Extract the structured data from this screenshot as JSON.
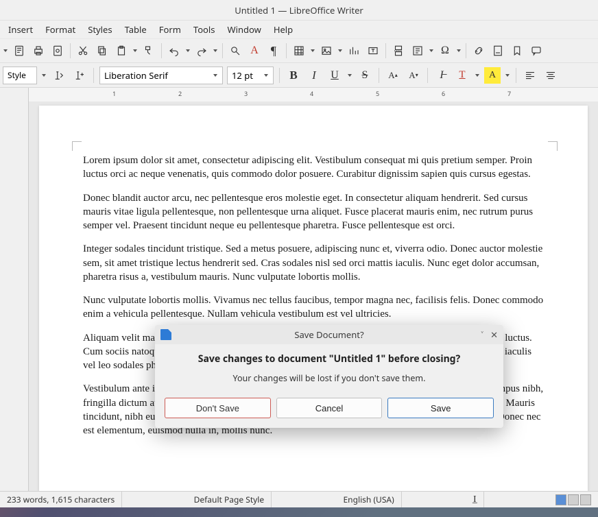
{
  "titlebar": "Untitled 1 — LibreOffice Writer",
  "menu": [
    "Insert",
    "Format",
    "Styles",
    "Table",
    "Form",
    "Tools",
    "Window",
    "Help"
  ],
  "toolbar2": {
    "style_label": "Style",
    "font_name": "Liberation Serif",
    "font_size": "12 pt"
  },
  "document": {
    "paragraphs": [
      "Lorem ipsum dolor sit amet, consectetur adipiscing elit. Vestibulum consequat mi quis pretium semper. Proin luctus orci ac neque venenatis, quis commodo dolor posuere. Curabitur dignissim sapien quis cursus egestas.",
      "Donec blandit auctor arcu, nec pellentesque eros molestie eget. In consectetur aliquam hendrerit. Sed cursus mauris vitae ligula pellentesque, non pellentesque urna aliquet. Fusce placerat mauris enim, nec rutrum purus semper vel. Praesent tincidunt neque eu pellentesque pharetra. Fusce pellentesque est orci.",
      "Integer sodales tincidunt tristique. Sed a metus posuere, adipiscing nunc et, viverra odio. Donec auctor molestie sem, sit amet tristique lectus hendrerit sed. Cras sodales nisl sed orci mattis iaculis. Nunc eget dolor accumsan, pharetra risus a, vestibulum mauris. Nunc vulputate lobortis mollis.",
      "Nunc vulputate lobortis mollis. Vivamus nec tellus faucibus, tempor magna nec, facilisis felis. Donec commodo enim a vehicula pellentesque. Nullam vehicula vestibulum est vel ultricies.",
      "Aliquam velit massa, laoreet vel leo nec, volutpat facilisis eros. Donec consequat arcu ut diam tempor luctus. Cum sociis natoque penatibus et magnis dis parturient montes, nascetur ridiculus mus. Praesent lorem iaculis vel leo sodales pharetra a a nibh.",
      "Vestibulum ante ipsum primis in faucibus orci luctus et ultrices posuere cubilia Curae; Nam luctus tempus nibh, fringilla dictum augue consectetur eget. Curabitur at ante sit amet tortor pharetra molestie eu nec ante. Mauris tincidunt, nibh eu sollicitudin molestie, dolor sapien congue tortor, a pulvinar sapien turpis sed ante. Donec nec est elementum, euismod nulla in, mollis nunc."
    ]
  },
  "dialog": {
    "title": "Save Document?",
    "headline": "Save changes to document \"Untitled 1\" before closing?",
    "subtext": "Your changes will be lost if you don't save them.",
    "dont_save": "Don't Save",
    "cancel": "Cancel",
    "save": "Save"
  },
  "status": {
    "words": "233 words, 1,615 characters",
    "page_style": "Default Page Style",
    "language": "English (USA)"
  },
  "ruler_numbers": [
    "1",
    "2",
    "3",
    "4",
    "5",
    "6",
    "7"
  ]
}
